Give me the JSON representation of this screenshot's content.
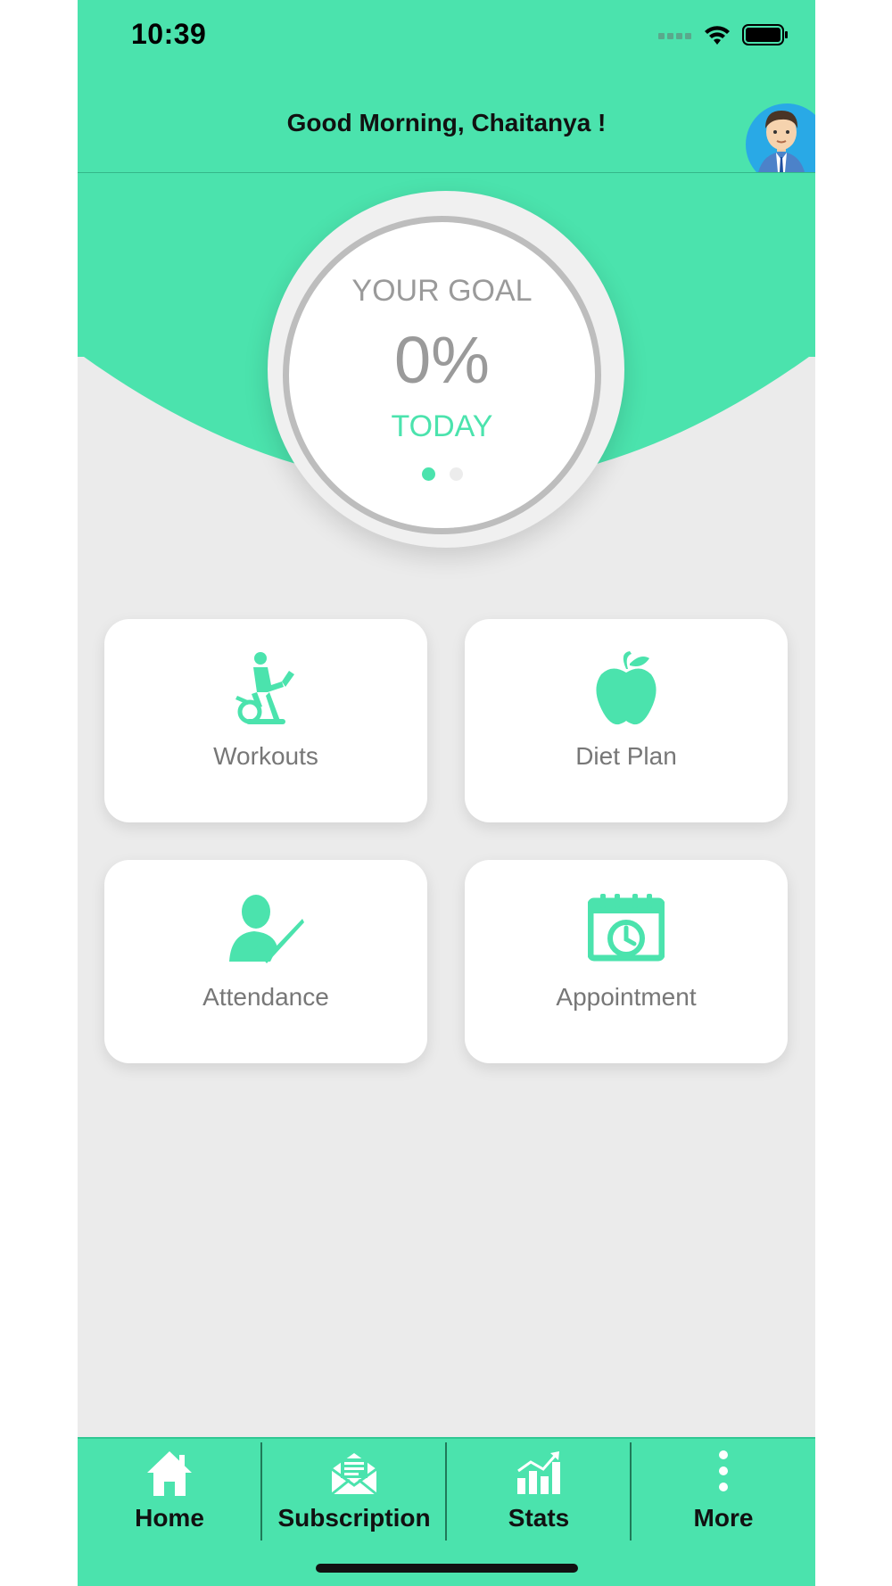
{
  "status_bar": {
    "time": "10:39"
  },
  "header": {
    "greeting": "Good Morning, Chaitanya !"
  },
  "goal": {
    "label": "YOUR GOAL",
    "value": "0%",
    "period": "TODAY",
    "progress": 0,
    "page_count": 2,
    "active_page": 1
  },
  "cards": [
    {
      "label": "Workouts",
      "icon": "exercise-bike-icon"
    },
    {
      "label": "Diet Plan",
      "icon": "apple-icon"
    },
    {
      "label": "Attendance",
      "icon": "person-check-icon"
    },
    {
      "label": "Appointment",
      "icon": "calendar-clock-icon"
    }
  ],
  "tabbar": {
    "items": [
      {
        "label": "Home",
        "icon": "home-icon"
      },
      {
        "label": "Subscription",
        "icon": "envelope-icon"
      },
      {
        "label": "Stats",
        "icon": "bar-chart-icon"
      },
      {
        "label": "More",
        "icon": "more-vertical-icon"
      }
    ]
  },
  "colors": {
    "accent": "#4be3ad",
    "background": "#ebebeb",
    "card": "#ffffff",
    "text_muted": "#9a9a9a"
  }
}
